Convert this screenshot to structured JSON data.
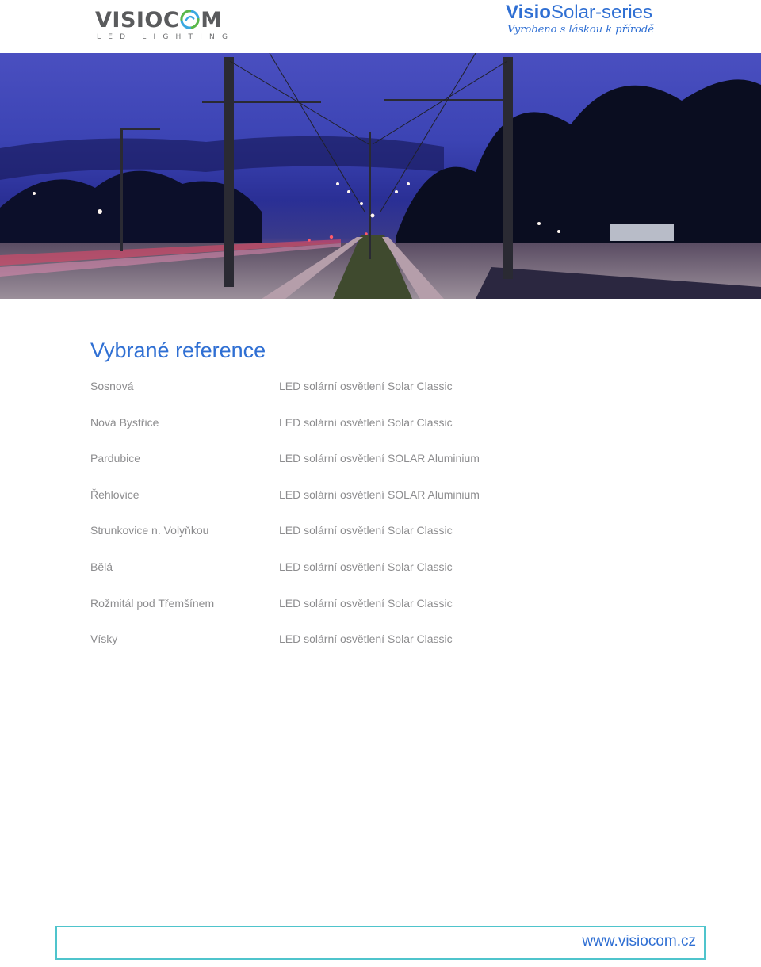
{
  "header": {
    "logo": {
      "word_left": "VISIOC",
      "word_right": "M",
      "subtitle": "LED LIGHTING"
    },
    "brand": {
      "bold": "Visio",
      "rest": "Solar-series",
      "tagline": "Vyrobeno s láskou k přírodě"
    }
  },
  "hero": {
    "icon": "street-lights-at-dusk-photo"
  },
  "content": {
    "title": "Vybrané reference",
    "references": [
      {
        "place": "Sosnová",
        "product": "LED solární osvětlení Solar Classic"
      },
      {
        "place": "Nová Bystřice",
        "product": "LED solární osvětlení Solar Classic"
      },
      {
        "place": "Pardubice",
        "product": "LED solární osvětlení SOLAR Aluminium"
      },
      {
        "place": "Řehlovice",
        "product": "LED solární osvětlení SOLAR Aluminium"
      },
      {
        "place": "Strunkovice n. Volyňkou",
        "product": "LED solární osvětlení Solar Classic"
      },
      {
        "place": "Bělá",
        "product": "LED solární osvětlení Solar Classic"
      },
      {
        "place": "Rožmitál pod Třemšínem",
        "product": "LED solární osvětlení Solar Classic"
      },
      {
        "place": "Vísky",
        "product": "LED solární osvětlení Solar Classic"
      }
    ]
  },
  "footer": {
    "url": "www.visiocom.cz"
  },
  "colors": {
    "accent": "#2f6fd3",
    "text_gray": "#8d8d8f",
    "frame": "#4fc4cc"
  }
}
